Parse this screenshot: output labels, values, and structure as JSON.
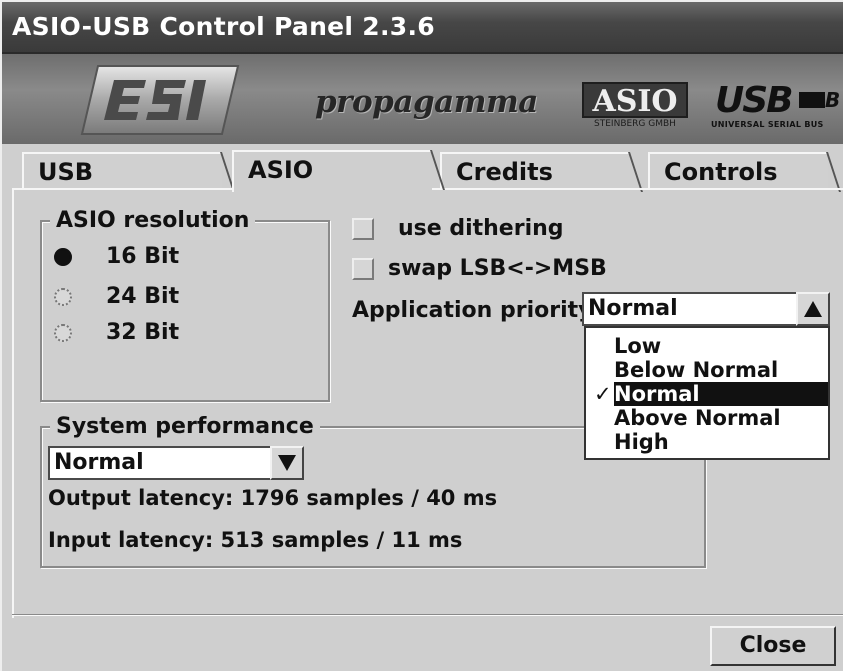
{
  "window": {
    "title": "ASIO-USB Control Panel 2.3.6"
  },
  "banner": {
    "logo_propagamma": "propagamma",
    "logo_asio": "ASIO",
    "logo_asio_sub": "STEINBERG GMBH",
    "logo_usb": "USB",
    "logo_usb_b": "B",
    "logo_usb_sub": "UNIVERSAL SERIAL BUS"
  },
  "tabs": [
    {
      "label": "USB",
      "active": false
    },
    {
      "label": "ASIO",
      "active": true
    },
    {
      "label": "Credits",
      "active": false
    },
    {
      "label": "Controls",
      "active": false
    }
  ],
  "asio_resolution": {
    "legend": "ASIO resolution",
    "options": [
      {
        "label": "16 Bit",
        "selected": true
      },
      {
        "label": "24 Bit",
        "selected": false
      },
      {
        "label": "32 Bit",
        "selected": false
      }
    ]
  },
  "options": {
    "use_dithering": {
      "label": "use dithering",
      "checked": false
    },
    "swap_lsb_msb": {
      "label": "swap LSB<->MSB",
      "checked": false
    }
  },
  "app_priority": {
    "label": "Application priority:",
    "value": "Normal",
    "options": [
      "Low",
      "Below Normal",
      "Normal",
      "Above Normal",
      "High"
    ],
    "selected_index": 2,
    "check_glyph": "✓"
  },
  "system_performance": {
    "legend": "System performance",
    "value": "Normal",
    "output_latency": "Output latency: 1796 samples / 40 ms",
    "input_latency": "Input latency: 513 samples / 11 ms"
  },
  "footer": {
    "close_label": "Close"
  },
  "colors": {
    "titlebar": "#474747",
    "face": "#cfcfcf",
    "highlight": "#111111"
  }
}
